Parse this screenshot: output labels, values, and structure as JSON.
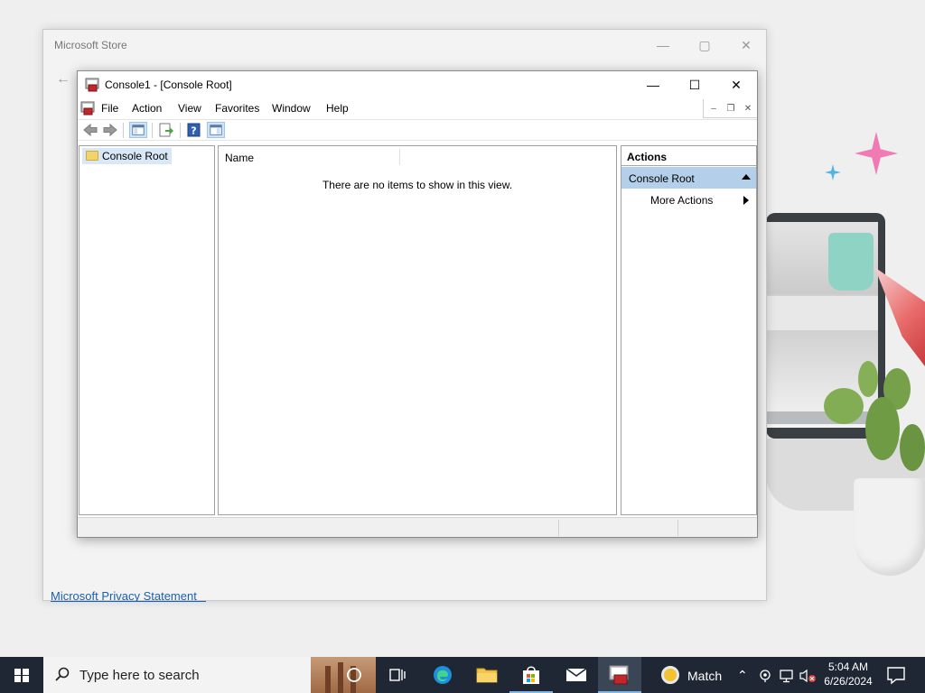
{
  "store": {
    "title": "Microsoft Store",
    "minimize": "—",
    "maximize": "▢",
    "close": "✕",
    "back": "←",
    "privacy_link": "Microsoft Privacy Statement"
  },
  "mmc": {
    "title": "Console1 - [Console Root]",
    "minimize": "—",
    "maximize": "☐",
    "close": "✕",
    "menu": [
      "File",
      "Action",
      "View",
      "Favorites",
      "Window",
      "Help"
    ],
    "mdi": {
      "minimize": "–",
      "restore": "❐",
      "close": "✕"
    },
    "tree": {
      "root": "Console Root"
    },
    "list": {
      "column_name": "Name",
      "empty_message": "There are no items to show in this view."
    },
    "actions": {
      "header": "Actions",
      "group": "Console Root",
      "item": "More Actions"
    }
  },
  "taskbar": {
    "search_placeholder": "Type here to search",
    "weather_text": "Match",
    "time": "5:04 AM",
    "date": "6/26/2024"
  },
  "colors": {
    "taskbar_bg": "#1f2734",
    "selection": "#d9e8f7",
    "actions_group": "#b3cfe9",
    "link": "#1a5fb4"
  }
}
